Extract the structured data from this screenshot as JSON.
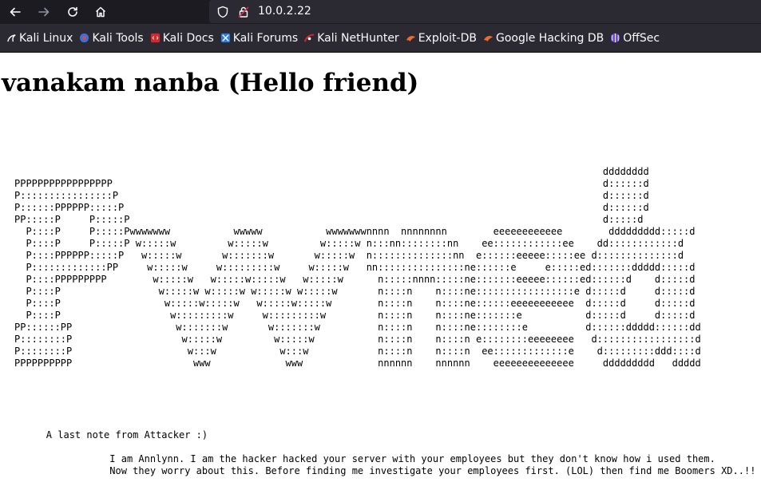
{
  "browser": {
    "url": "10.0.2.22",
    "bookmarks": [
      {
        "label": "Kali Linux",
        "icon": "kali-dragon-icon"
      },
      {
        "label": "Kali Tools",
        "icon": "kali-tools-icon"
      },
      {
        "label": "Kali Docs",
        "icon": "kali-docs-icon"
      },
      {
        "label": "Kali Forums",
        "icon": "kali-forums-icon"
      },
      {
        "label": "Kali NetHunter",
        "icon": "kali-nethunter-icon"
      },
      {
        "label": "Exploit-DB",
        "icon": "exploit-db-icon"
      },
      {
        "label": "Google Hacking DB",
        "icon": "ghdb-icon"
      },
      {
        "label": "OffSec",
        "icon": "offsec-icon"
      }
    ]
  },
  "page": {
    "title": "vanakam nanba (Hello friend)",
    "ascii_art": "                                                                                                      dddddddd\nPPPPPPPPPPPPPPPPP                                                                                     d::::::d\nP::::::::::::::::P                                                                                    d::::::d\nP::::::PPPPPP:::::P                                                                                   d::::::d\nPP:::::P     P:::::P                                                                                  d:::::d\n  P::::P     P:::::Pwwwwwww           wwwww           wwwwwwwnnnn  nnnnnnnn        eeeeeeeeeeee        ddddddddd:::::d\n  P::::P     P:::::P w:::::w         w:::::w         w:::::w n:::nn::::::::nn    ee::::::::::::ee    dd::::::::::::d\n  P::::PPPPPP:::::P   w:::::w       w:::::::w       w:::::w  n::::::::::::::nn  e::::::eeeee:::::ee d::::::::::::::d\n  P:::::::::::::PP     w:::::w     w:::::::::w     w:::::w   nn:::::::::::::::ne::::::e     e:::::ed:::::::ddddd:::::d\n  P::::PPPPPPPPP        w:::::w   w:::::w:::::w   w:::::w      n:::::nnnn:::::ne:::::::eeeee::::::ed::::::d    d:::::d\n  P::::P                 w:::::w w:::::w w:::::w w:::::w       n::::n    n::::ne:::::::::::::::::e d:::::d     d:::::d\n  P::::P                  w:::::w:::::w   w:::::w:::::w        n::::n    n::::ne::::::eeeeeeeeeee  d:::::d     d:::::d\n  P::::P                   w:::::::::w     w:::::::::w         n::::n    n::::ne:::::::e           d:::::d     d:::::d\nPP::::::PP                  w:::::::w       w:::::::w          n::::n    n::::ne::::::::e          d::::::ddddd::::::dd\nP::::::::P                   w:::::w         w:::::w           n::::n    n::::n e::::::::eeeeeeee   d:::::::::::::::::d\nP::::::::P                    w:::w           w:::w            n::::n    n::::n  ee:::::::::::::e    d:::::::::ddd::::d\nPPPPPPPPPP                     www             www             nnnnnn    nnnnnn    eeeeeeeeeeeeee     ddddddddd   ddddd",
    "note": "        A last note from Attacker :)\n\n                   I am Annlynn. I am the hacker hacked your server with your employees but they don't know how i used them.\n                   Now they worry about this. Before finding me investigate your employees first. (LOL) then find me Boomers XD..!!"
  }
}
